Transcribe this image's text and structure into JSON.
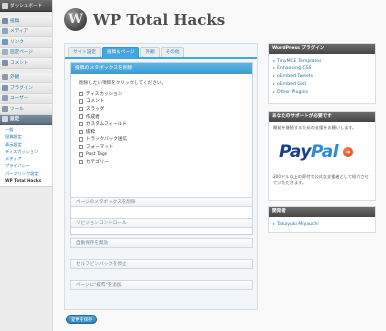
{
  "sidebar": {
    "dashboard": "ダッシュボード",
    "items": [
      {
        "label": "投稿",
        "icon": "pin-icon",
        "color": "#7a8c9c"
      },
      {
        "label": "メディア",
        "icon": "media-icon",
        "color": "#8aa7bb"
      },
      {
        "label": "リンク",
        "icon": "link-icon",
        "color": "#6c9bc0"
      },
      {
        "label": "固定ページ",
        "icon": "page-icon",
        "color": "#9fb0bf"
      },
      {
        "label": "コメント",
        "icon": "comment-icon",
        "color": "#7c93a8"
      }
    ],
    "items2": [
      {
        "label": "外観",
        "icon": "appearance-icon",
        "color": "#8d9aa6"
      },
      {
        "label": "プラグイン",
        "icon": "plugin-icon",
        "color": "#7d96ad"
      },
      {
        "label": "ユーザー",
        "icon": "user-icon",
        "color": "#8aa0b4"
      },
      {
        "label": "ツール",
        "icon": "tools-icon",
        "color": "#8c98a4"
      }
    ],
    "settings": {
      "label": "設定",
      "icon": "settings-icon",
      "color": "#cfd9e2"
    },
    "submenu": [
      "一般",
      "投稿設定",
      "表示設定",
      "ディスカッション",
      "メディア",
      "プライバシー",
      "パーマリンク設定",
      "WP Total Hacks"
    ]
  },
  "header": {
    "logo_letter": "W",
    "title": "WP Total Hacks"
  },
  "tabs": [
    "サイト設定",
    "投稿＆ページ",
    "外観",
    "その他"
  ],
  "active_tab": 1,
  "meta_panel": {
    "title": "投稿のメタボックスを削除",
    "instruction": "削除したい項目をクリックしてください。",
    "options": [
      "ディスカッション",
      "コメント",
      "スラッグ",
      "作成者",
      "カスタムフィールド",
      "抜粋",
      "トラックバック送信",
      "フォーマット",
      "Post Tags",
      "カテゴリー"
    ]
  },
  "sections": [
    "ページのメタボックスを削除",
    "リビジョンコントロール",
    "自動保存を無効",
    "セルフピンバックを停止",
    "ページに\"抜粋\"を追加"
  ],
  "save_button": "変更を保存",
  "plugins_box": {
    "title": "WordPress プラグイン",
    "links": [
      "TinyMCE Templates",
      "Enhancing CSS",
      "oEmbed Tweets",
      "oEmbed Gist",
      "Other Plugins"
    ]
  },
  "support_box": {
    "title": "あなたのサポートが必要です",
    "text1": "開発を継続するための支援をお願いします。",
    "paypal_p1": "Pay",
    "paypal_p2": "Pal",
    "text2": "200ドル以上の寄付で公式な支援者として紹介させていただきます。"
  },
  "author_box": {
    "title": "開発者",
    "author": "Takayuki Miyauchi"
  }
}
